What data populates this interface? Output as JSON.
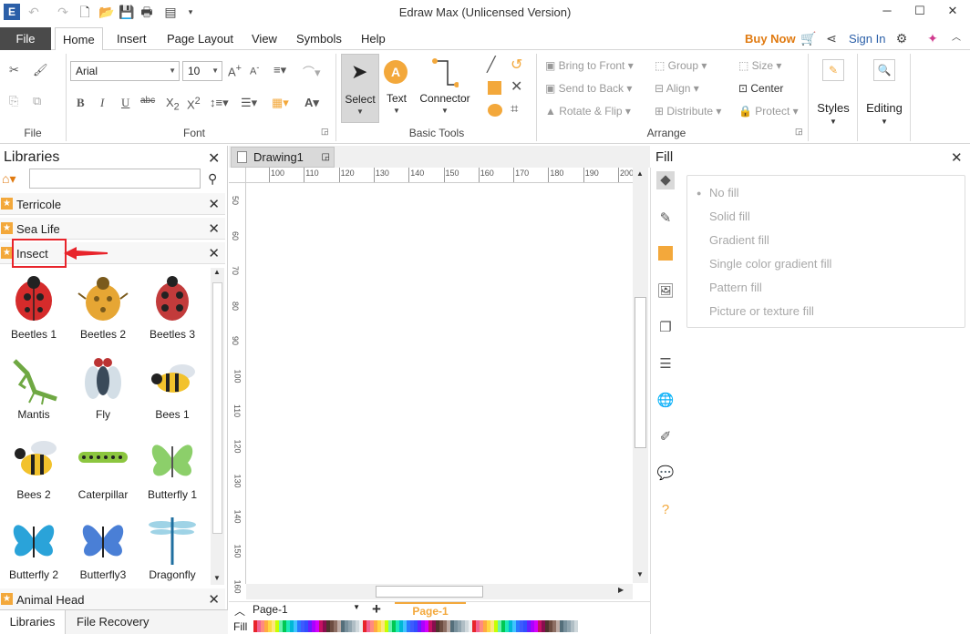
{
  "app": {
    "title": "Edraw Max (Unlicensed Version)"
  },
  "menu": {
    "file": "File",
    "tabs": [
      "Home",
      "Insert",
      "Page Layout",
      "View",
      "Symbols",
      "Help"
    ],
    "buy_now": "Buy Now",
    "sign_in": "Sign In"
  },
  "ribbon": {
    "groups": {
      "file": "File",
      "font": "Font",
      "basic_tools": "Basic Tools",
      "arrange": "Arrange"
    },
    "font_name": "Arial",
    "font_size": "10",
    "tools": {
      "select": "Select",
      "text": "Text",
      "connector": "Connector"
    },
    "arrange": {
      "bring_to_front": "Bring to Front",
      "send_to_back": "Send to Back",
      "rotate_flip": "Rotate & Flip",
      "group": "Group",
      "align": "Align",
      "distribute": "Distribute",
      "size": "Size",
      "center": "Center",
      "protect": "Protect"
    },
    "styles": "Styles",
    "editing": "Editing"
  },
  "libraries": {
    "title": "Libraries",
    "search_placeholder": "",
    "items": [
      "Terricole",
      "Sea Life",
      "Insect"
    ],
    "shapes": [
      "Beetles 1",
      "Beetles 2",
      "Beetles 3",
      "Mantis",
      "Fly",
      "Bees 1",
      "Bees 2",
      "Caterpillar",
      "Butterfly 1",
      "Butterfly 2",
      "Butterfly3",
      "Dragonfly"
    ],
    "bottom_item": "Animal Head",
    "bottom_tabs": [
      "Libraries",
      "File Recovery"
    ]
  },
  "document": {
    "tab": "Drawing1",
    "ruler_h": [
      "100",
      "110",
      "120",
      "130",
      "140",
      "150",
      "160",
      "170",
      "180",
      "190",
      "200"
    ],
    "ruler_v": [
      "50",
      "60",
      "70",
      "80",
      "90",
      "100",
      "110",
      "120",
      "130",
      "140",
      "150",
      "160"
    ],
    "page_selector": "Page-1",
    "active_page": "Page-1",
    "fill_label": "Fill"
  },
  "fill_panel": {
    "title": "Fill",
    "options": [
      "No fill",
      "Solid fill",
      "Gradient fill",
      "Single color gradient fill",
      "Pattern fill",
      "Picture or texture fill"
    ],
    "selected": "No fill"
  },
  "colors": {
    "accent_orange": "#f3a83b",
    "highlight_red": "#e8242b",
    "brand_blue": "#2b5fa8"
  },
  "icons": [
    "undo-icon",
    "redo-icon",
    "new-icon",
    "open-icon",
    "save-icon",
    "print-icon",
    "export-icon",
    "share-icon",
    "settings-icon",
    "search-icon",
    "home-icon"
  ]
}
